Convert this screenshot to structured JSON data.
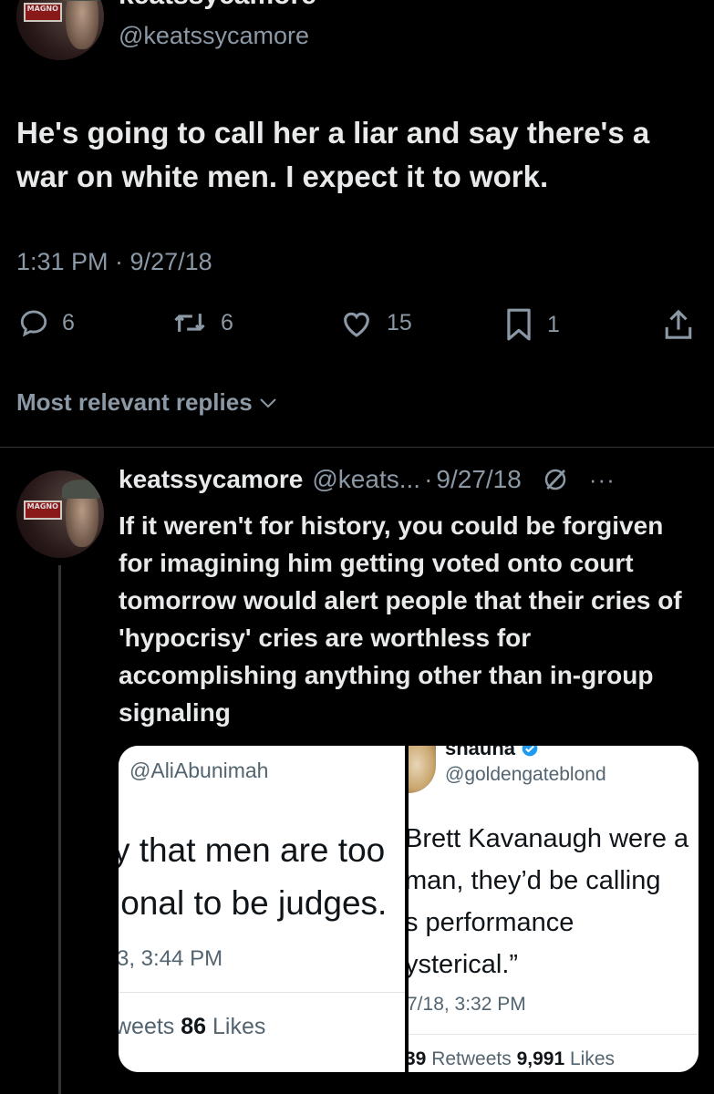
{
  "main_tweet": {
    "name_partial": "keatssycamore",
    "handle": "@keatssycamore",
    "avatar_sign_text": "MAGNO",
    "text": "He's going to call her a liar and say there's a war on white men. I expect it to work.",
    "timestamp": "1:31 PM · 9/27/18",
    "actions": {
      "replies": "6",
      "retweets": "6",
      "likes": "15",
      "bookmarks": "1"
    }
  },
  "replies_sort": {
    "label": "Most relevant replies"
  },
  "reply": {
    "name": "keatssycamore",
    "handle": "@keats...",
    "separator": "·",
    "date": "9/27/18",
    "more": "···",
    "avatar_sign_text": "MAGNO",
    "text": "If it weren't for history, you could be forgiven for imagining him getting voted onto court tomorrow would alert people that their cries of 'hypocrisy' cries are worthless for accomplishing anything other than in-group signaling",
    "media": {
      "left": {
        "handle": "@AliAbunimah",
        "line1": "y that men are too",
        "line2": "ional to be judges.",
        "time": "3, 3:44 PM",
        "stats_prefix": "weets ",
        "likes_count": "86",
        "likes_label": " Likes"
      },
      "right": {
        "name": "shauna",
        "handle": "@goldengateblond",
        "line1": "Brett Kavanaugh were a",
        "line2": "man, they’d be calling",
        "line3": "s performance",
        "line4": "ysterical.”",
        "time": "7/18, 3:32 PM",
        "retweets_count": "39",
        "retweets_label": " Retweets ",
        "likes_count": "9,991",
        "likes_label": " Likes"
      }
    }
  },
  "colors": {
    "background": "#000000",
    "text_primary": "#e7e9ea",
    "text_secondary": "#8b98a5",
    "divider": "#2f3336",
    "verified": "#1d9bf0"
  }
}
